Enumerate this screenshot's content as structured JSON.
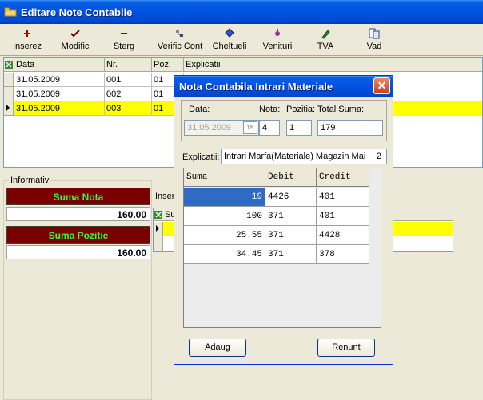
{
  "window": {
    "title": "Editare Note Contabile"
  },
  "toolbar": {
    "buttons": [
      {
        "label": "Inserez",
        "icon": "plus-icon"
      },
      {
        "label": "Modific",
        "icon": "check-icon"
      },
      {
        "label": "Sterg",
        "icon": "minus-icon"
      },
      {
        "label": "Verific Cont",
        "icon": "verify-icon"
      },
      {
        "label": "Cheltueli",
        "icon": "expense-icon"
      },
      {
        "label": "Venituri",
        "icon": "income-icon"
      },
      {
        "label": "TVA",
        "icon": "pencil-icon"
      },
      {
        "label": "Vad",
        "icon": "view-icon"
      }
    ]
  },
  "main_grid": {
    "columns": [
      "Data",
      "Nr.",
      "Poz.",
      "Explicatii"
    ],
    "rows": [
      {
        "data": "31.05.2009",
        "nr": "001",
        "poz": "01"
      },
      {
        "data": "31.05.2009",
        "nr": "002",
        "poz": "01"
      },
      {
        "data": "31.05.2009",
        "nr": "003",
        "poz": "01"
      }
    ]
  },
  "info": {
    "legend": "Informativ",
    "suma_nota_label": "Suma Nota",
    "suma_nota_value": "160.00",
    "suma_pozitie_label": "Suma Pozitie",
    "suma_pozitie_value": "160.00"
  },
  "detail": {
    "label": "Insere",
    "col0": "Su"
  },
  "dialog": {
    "title": "Nota Contabila Intrari Materiale",
    "labels": {
      "data": "Data:",
      "nota": "Nota:",
      "pozitia": "Pozitia:",
      "total": "Total Suma:",
      "explicatii": "Explicatii:"
    },
    "values": {
      "data": "31.05.2009",
      "calendar": "15",
      "nota": "4",
      "pozitia": "1",
      "total": "179",
      "explicatii": "Intrari Marfa(Materiale) Magazin Mai",
      "explicatii_nr": "2"
    },
    "grid": {
      "columns": [
        "Suma",
        "Debit",
        "Credit"
      ],
      "rows": [
        {
          "suma": "19",
          "debit": "4426",
          "credit": "401"
        },
        {
          "suma": "100",
          "debit": "371",
          "credit": "401"
        },
        {
          "suma": "25.55",
          "debit": "371",
          "credit": "4428"
        },
        {
          "suma": "34.45",
          "debit": "371",
          "credit": "378"
        }
      ]
    },
    "buttons": {
      "add": "Adaug",
      "cancel": "Renunt"
    }
  },
  "colors": {
    "titlebar": "#0055e5",
    "highlight_row": "#ffff00",
    "sum_header_bg": "#7a0000",
    "sum_header_text": "#33ff33",
    "selection": "#316ac5"
  }
}
